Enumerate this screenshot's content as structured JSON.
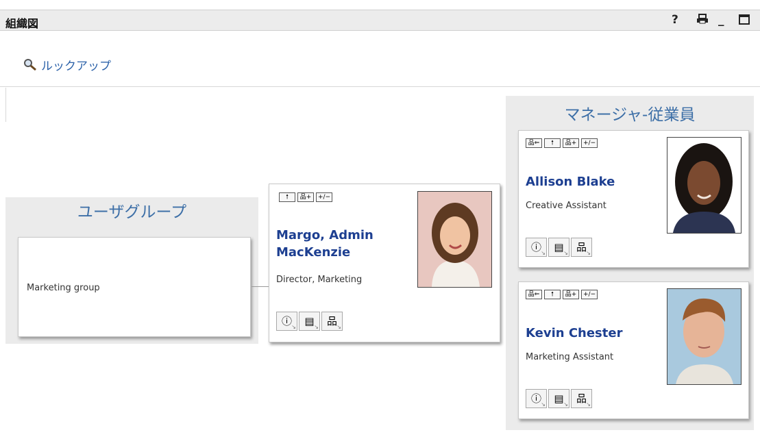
{
  "window": {
    "title": "組織図",
    "help_label": "?",
    "print_label": "🖶",
    "minimize_label": "_",
    "maximize_label": "□"
  },
  "lookup": {
    "label": "ルックアップ",
    "icon": "magnifier-icon"
  },
  "user_group_panel": {
    "title": "ユーザグループ",
    "group": {
      "name": "Marketing group"
    }
  },
  "focus_user": {
    "name": "Margo, Admin MacKenzie",
    "title": "Director, Marketing",
    "toolbar": [
      "🠕",
      "品+",
      "+/−"
    ]
  },
  "manager_panel": {
    "title": "マネージャ-従業員",
    "employees": [
      {
        "name": "Allison Blake",
        "title": "Creative Assistant",
        "toolbar": [
          "品⇐",
          "🠕",
          "品+",
          "+/−"
        ]
      },
      {
        "name": "Kevin Chester",
        "title": "Marketing Assistant",
        "toolbar": [
          "品⇐",
          "🠕",
          "品+",
          "+/−"
        ]
      }
    ]
  },
  "action_icons": [
    "ⓘ",
    "▤",
    "品"
  ],
  "colors": {
    "panel_bg": "#ebebeb",
    "title_blue": "#3d6fa7",
    "name_blue": "#1d3f91",
    "link_blue": "#2c62a9"
  }
}
